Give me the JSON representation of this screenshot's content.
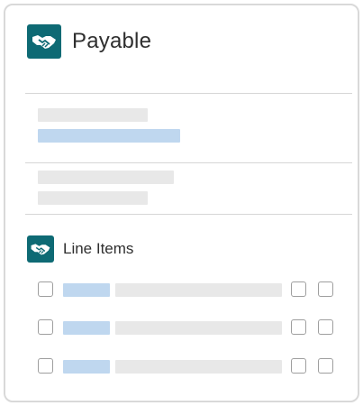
{
  "header": {
    "title": "Payable",
    "icon": "handshake-icon"
  },
  "line_items_section": {
    "title": "Line Items",
    "icon": "handshake-icon",
    "rows": [
      {
        "checked": false,
        "actions": [
          "checkbox",
          "checkbox"
        ]
      },
      {
        "checked": false,
        "actions": [
          "checkbox",
          "checkbox"
        ]
      },
      {
        "checked": false,
        "actions": [
          "checkbox",
          "checkbox"
        ]
      }
    ]
  },
  "colors": {
    "brand": "#0e6a74",
    "placeholder_gray": "#e8e8e8",
    "placeholder_blue": "#bfd7ef",
    "border": "#d9d9d9"
  }
}
